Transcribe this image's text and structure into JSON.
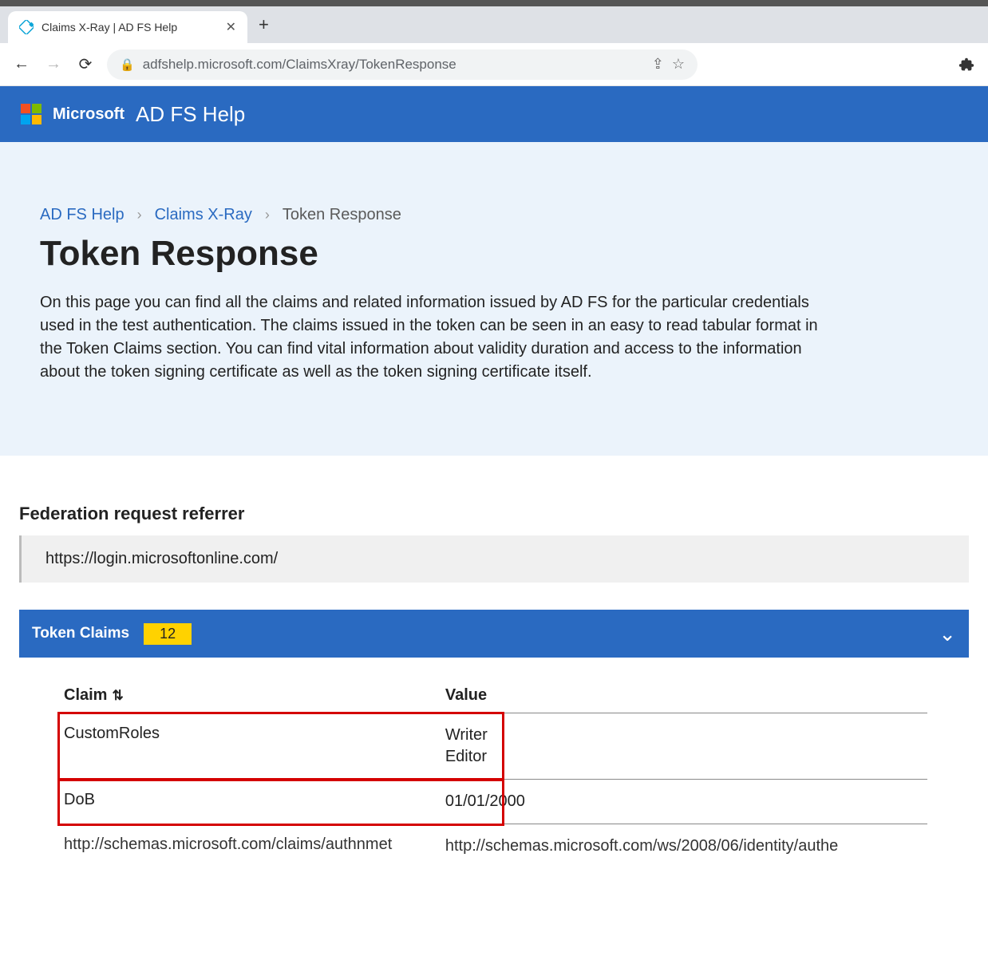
{
  "browser": {
    "tab_title": "Claims X-Ray | AD FS Help",
    "url": "adfshelp.microsoft.com/ClaimsXray/TokenResponse"
  },
  "header": {
    "brand": "Microsoft",
    "site": "AD FS Help"
  },
  "hero": {
    "crumb1": "AD FS Help",
    "crumb2": "Claims X-Ray",
    "crumb3": "Token Response",
    "title": "Token Response",
    "description": "On this page you can find all the claims and related information issued by AD FS for the particular credentials used in the test authentication. The claims issued in the token can be seen in an easy to read tabular format in the Token Claims section. You can find vital information about validity duration and access to the information about the token signing certificate as well as the token signing certificate itself."
  },
  "federation": {
    "label": "Federation request referrer",
    "value": "https://login.microsoftonline.com/"
  },
  "claims_section": {
    "title": "Token Claims",
    "count": "12",
    "col_claim": "Claim",
    "col_value": "Value",
    "rows": [
      {
        "claim": "CustomRoles",
        "value_lines": [
          "Writer",
          "Editor"
        ]
      },
      {
        "claim": "DoB",
        "value_lines": [
          "01/01/2000"
        ]
      },
      {
        "claim": "http://schemas.microsoft.com/claims/authnmet",
        "value_lines": [
          "http://schemas.microsoft.com/ws/2008/06/identity/authe"
        ]
      }
    ]
  }
}
